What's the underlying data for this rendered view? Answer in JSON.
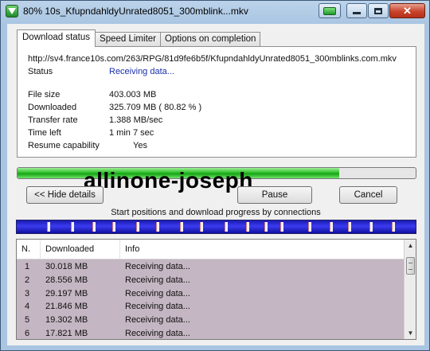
{
  "window": {
    "title": "80% 10s_KfupndahldyUnrated8051_300mblink...mkv",
    "buttons": {
      "minimize": "minimize-icon",
      "maximize": "maximize-icon",
      "close": "✕"
    }
  },
  "tabs": [
    {
      "label": "Download status",
      "active": true
    },
    {
      "label": "Speed Limiter",
      "active": false
    },
    {
      "label": "Options on completion",
      "active": false
    }
  ],
  "status_panel": {
    "url": "http://sv4.france10s.com/263/RPG/81d9fe6b5f/KfupndahldyUnrated8051_300mblinks.com.mkv",
    "status_label": "Status",
    "status_value": "Receiving data...",
    "file_size_label": "File size",
    "file_size_value": "403.003  MB",
    "downloaded_label": "Downloaded",
    "downloaded_value": "325.709  MB  ( 80.82 % )",
    "transfer_rate_label": "Transfer rate",
    "transfer_rate_value": "1.388  MB/sec",
    "time_left_label": "Time left",
    "time_left_value": "1 min 7 sec",
    "resume_label": "Resume capability",
    "resume_value": "Yes"
  },
  "progress": {
    "fraction": 0.8082,
    "color": "#2fbf2a"
  },
  "watermark": "allinone-joseph",
  "buttons": {
    "hide_details": "<< Hide details",
    "pause": "Pause",
    "cancel": "Cancel"
  },
  "connections": {
    "caption": "Start positions and download progress by connections",
    "segment_starts": [
      0.075,
      0.135,
      0.19,
      0.24,
      0.3,
      0.35,
      0.41,
      0.46,
      0.52,
      0.575,
      0.62,
      0.66,
      0.73,
      0.785,
      0.83,
      0.885,
      0.94
    ]
  },
  "list": {
    "headers": {
      "n": "N.",
      "downloaded": "Downloaded",
      "info": "Info"
    },
    "rows": [
      {
        "n": "1",
        "downloaded": "30.018  MB",
        "info": "Receiving data..."
      },
      {
        "n": "2",
        "downloaded": "28.556  MB",
        "info": "Receiving data..."
      },
      {
        "n": "3",
        "downloaded": "29.197  MB",
        "info": "Receiving data..."
      },
      {
        "n": "4",
        "downloaded": "21.846  MB",
        "info": "Receiving data..."
      },
      {
        "n": "5",
        "downloaded": "19.302  MB",
        "info": "Receiving data..."
      },
      {
        "n": "6",
        "downloaded": "17.821  MB",
        "info": "Receiving data..."
      }
    ]
  }
}
